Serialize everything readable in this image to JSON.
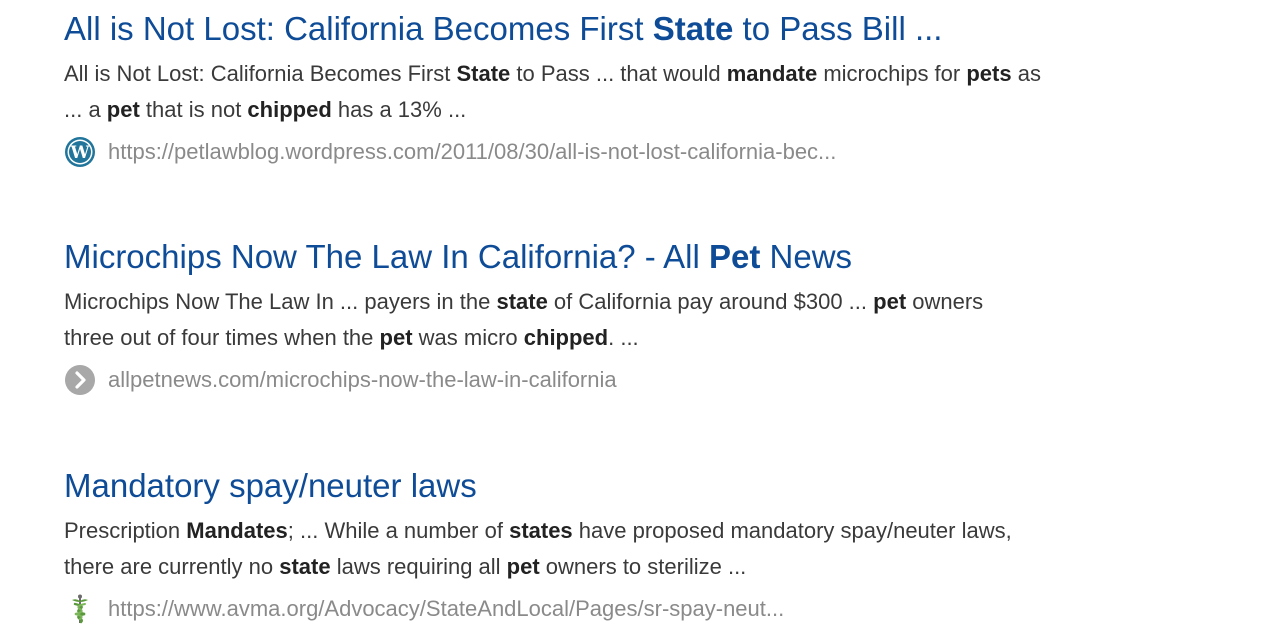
{
  "results": [
    {
      "title": [
        {
          "text": "All is Not Lost: California Becomes First ",
          "bold": false
        },
        {
          "text": "State",
          "bold": true
        },
        {
          "text": " to Pass Bill ...",
          "bold": false
        }
      ],
      "snippet_line1": [
        {
          "text": "All is Not Lost: California Becomes First ",
          "bold": false
        },
        {
          "text": "State",
          "bold": true
        },
        {
          "text": " to Pass ... that would ",
          "bold": false
        },
        {
          "text": "mandate",
          "bold": true
        },
        {
          "text": " microchips for ",
          "bold": false
        },
        {
          "text": "pets",
          "bold": true
        },
        {
          "text": " as",
          "bold": false
        }
      ],
      "snippet_line2": [
        {
          "text": "... a ",
          "bold": false
        },
        {
          "text": "pet",
          "bold": true
        },
        {
          "text": " that is not ",
          "bold": false
        },
        {
          "text": "chipped",
          "bold": true
        },
        {
          "text": " has a 13% ...",
          "bold": false
        }
      ],
      "url": "https://petlawblog.wordpress.com/2011/08/30/all-is-not-lost-california-bec...",
      "favicon": "wordpress-icon"
    },
    {
      "title": [
        {
          "text": "Microchips Now The Law In California? - All ",
          "bold": false
        },
        {
          "text": "Pet",
          "bold": true
        },
        {
          "text": " News",
          "bold": false
        }
      ],
      "snippet_line1": [
        {
          "text": "Microchips Now The Law In ... payers in the ",
          "bold": false
        },
        {
          "text": "state",
          "bold": true
        },
        {
          "text": " of California pay around $300 ... ",
          "bold": false
        },
        {
          "text": "pet",
          "bold": true
        },
        {
          "text": " owners",
          "bold": false
        }
      ],
      "snippet_line2": [
        {
          "text": "three out of four times when the ",
          "bold": false
        },
        {
          "text": "pet",
          "bold": true
        },
        {
          "text": " was micro ",
          "bold": false
        },
        {
          "text": "chipped",
          "bold": true
        },
        {
          "text": ". ...",
          "bold": false
        }
      ],
      "url": "allpetnews.com/microchips-now-the-law-in-california",
      "favicon": "chevron-right-circle-icon"
    },
    {
      "title": [
        {
          "text": "Mandatory spay/neuter laws",
          "bold": false
        }
      ],
      "snippet_line1": [
        {
          "text": "Prescription ",
          "bold": false
        },
        {
          "text": "Mandates",
          "bold": true
        },
        {
          "text": "; ... While a number of ",
          "bold": false
        },
        {
          "text": "states",
          "bold": true
        },
        {
          "text": " have proposed mandatory spay/neuter laws,",
          "bold": false
        }
      ],
      "snippet_line2": [
        {
          "text": "there are currently no ",
          "bold": false
        },
        {
          "text": "state",
          "bold": true
        },
        {
          "text": " laws requiring all ",
          "bold": false
        },
        {
          "text": "pet",
          "bold": true
        },
        {
          "text": " owners to sterilize ...",
          "bold": false
        }
      ],
      "url": "https://www.avma.org/Advocacy/StateAndLocal/Pages/sr-spay-neut...",
      "favicon": "caduceus-icon"
    }
  ],
  "colors": {
    "title": "#0f4c97",
    "snippet": "#3a3a3a",
    "url": "#8a8a8a",
    "wordpress": "#21759b",
    "chevron_bg": "#a8a8a8",
    "caduceus": "#5b9a3c"
  }
}
